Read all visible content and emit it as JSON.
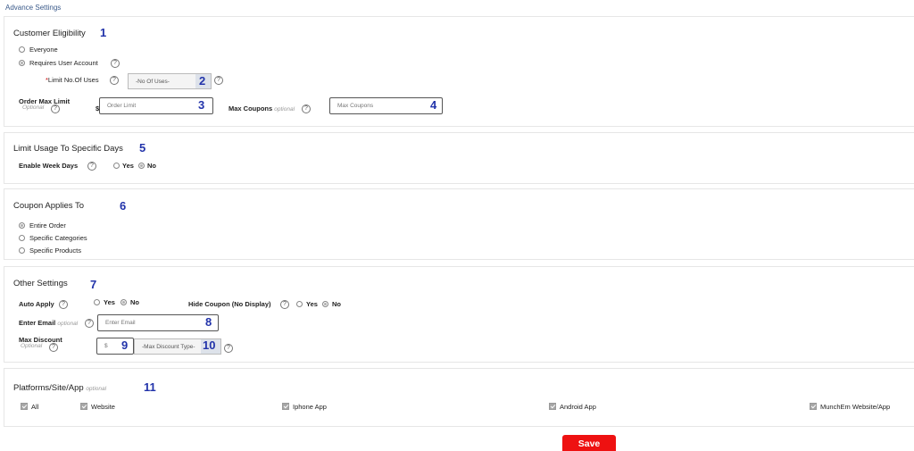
{
  "header": {
    "title": "Advance Settings"
  },
  "customer_eligibility": {
    "title": "Customer Eligibility",
    "marker": "1",
    "options": [
      "Everyone",
      "Requires User Account"
    ],
    "selected": 1,
    "limit_uses": {
      "required_mark": "*",
      "label": "Limit No.Of Uses",
      "value": "-No Of Uses-",
      "marker": "2"
    },
    "order_max_limit": {
      "label": "Order Max Limit",
      "optional": "Optional",
      "currency": "$",
      "placeholder": "Order Limit",
      "marker": "3"
    },
    "max_coupons": {
      "label": "Max Coupons",
      "optional": "optional",
      "placeholder": "Max Coupons",
      "marker": "4"
    }
  },
  "limit_days": {
    "title": "Limit Usage To Specific Days",
    "marker": "5",
    "enable_label": "Enable Week Days",
    "yes": "Yes",
    "no": "No",
    "selected": "No"
  },
  "coupon_applies": {
    "title": "Coupon Applies To",
    "marker": "6",
    "options": [
      "Entire Order",
      "Specific Categories",
      "Specific Products"
    ],
    "selected": 0
  },
  "other_settings": {
    "title": "Other Settings",
    "marker": "7",
    "auto_apply": {
      "label": "Auto Apply",
      "yes": "Yes",
      "no": "No",
      "selected": "No"
    },
    "hide_coupon": {
      "label": "Hide Coupon (No Display)",
      "yes": "Yes",
      "no": "No",
      "selected": "No"
    },
    "email": {
      "label": "Enter Email",
      "optional": "optional",
      "placeholder": "Enter Email",
      "marker": "8"
    },
    "max_discount": {
      "label": "Max Discount",
      "optional": "Optional",
      "currency_placeholder": "$",
      "marker_value": "9",
      "type_value": "-Max Discount Type-",
      "marker_type": "10"
    }
  },
  "platforms": {
    "title": "Platforms/Site/App",
    "optional": "optional",
    "marker": "11",
    "items": [
      "All",
      "Website",
      "Iphone App",
      "Android App",
      "MunchEm Website/App"
    ]
  },
  "save_label": "Save",
  "help_glyph": "?",
  "colors": {
    "accent": "#2233aa",
    "save": "#ee1111",
    "header": "#3a5a8a"
  }
}
